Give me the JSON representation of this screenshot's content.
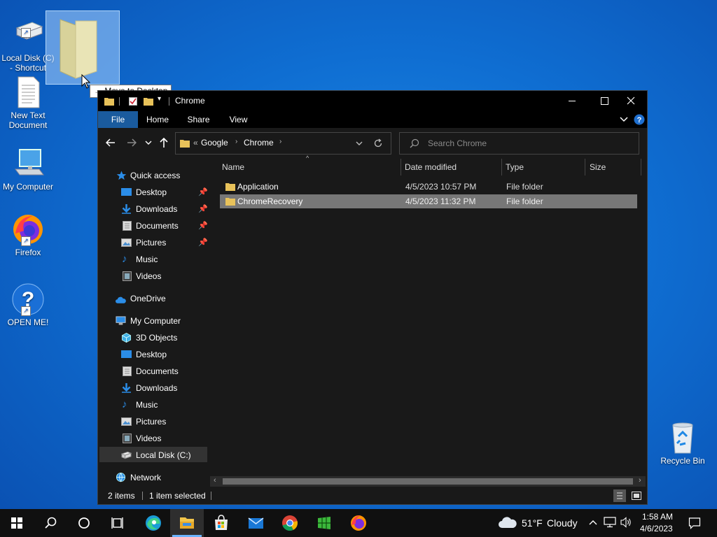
{
  "desktop": {
    "icons": [
      {
        "label": "Local Disk (C)\n- Shortcut",
        "icon": "drive-icon"
      },
      {
        "label": "New Text\nDocument",
        "icon": "text-document-icon"
      },
      {
        "label": "My Computer",
        "icon": "computer-icon"
      },
      {
        "label": "Firefox",
        "icon": "firefox-icon"
      },
      {
        "label": "OPEN ME!",
        "icon": "help-icon"
      },
      {
        "label": "Recycle Bin",
        "icon": "recycle-bin-icon"
      }
    ],
    "drag_tooltip": "Move to Desktop"
  },
  "explorer": {
    "title": "Chrome",
    "ribbon_tabs": [
      "File",
      "Home",
      "Share",
      "View"
    ],
    "breadcrumb": {
      "overflow": "«",
      "segments": [
        "Google",
        "Chrome"
      ]
    },
    "search_placeholder": "Search Chrome",
    "nav": {
      "quick_access": "Quick access",
      "quick_items": [
        "Desktop",
        "Downloads",
        "Documents",
        "Pictures",
        "Music",
        "Videos"
      ],
      "onedrive": "OneDrive",
      "my_computer": "My Computer",
      "computer_items": [
        "3D Objects",
        "Desktop",
        "Documents",
        "Downloads",
        "Music",
        "Pictures",
        "Videos",
        "Local Disk (C:)"
      ],
      "network": "Network"
    },
    "columns": [
      "Name",
      "Date modified",
      "Type",
      "Size"
    ],
    "rows": [
      {
        "name": "Application",
        "date": "4/5/2023 10:57 PM",
        "type": "File folder",
        "size": ""
      },
      {
        "name": "ChromeRecovery",
        "date": "4/5/2023 11:32 PM",
        "type": "File folder",
        "size": ""
      }
    ],
    "status": {
      "items": "2 items",
      "selected": "1 item selected"
    }
  },
  "taskbar": {
    "weather_temp": "51°F",
    "weather_desc": "Cloudy",
    "time": "1:58 AM",
    "date": "4/6/2023"
  },
  "colors": {
    "desktop_bg": "#0f6ed2",
    "explorer_bg": "#191919",
    "file_tab": "#1a5b9e",
    "selection": "#777777"
  }
}
